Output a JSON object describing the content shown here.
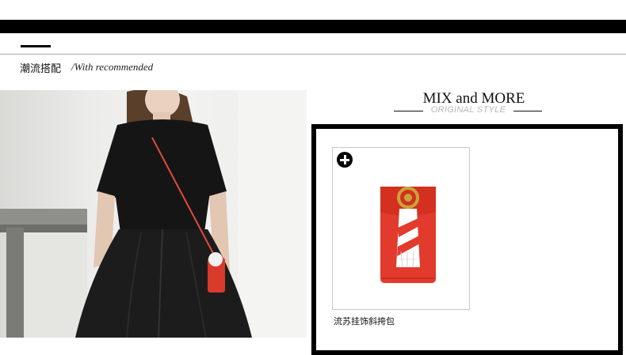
{
  "section": {
    "title": "潮流搭配",
    "subtitle": "/With recommended"
  },
  "mix": {
    "title": "MIX and MORE",
    "subtitle": "ORIGINAL STYLE"
  },
  "product": {
    "name": "流苏挂饰斜挎包",
    "icon": "plus-circle-icon",
    "color": "#e23a2c"
  },
  "colors": {
    "band": "#000000",
    "accent_red": "#e23a2c"
  }
}
